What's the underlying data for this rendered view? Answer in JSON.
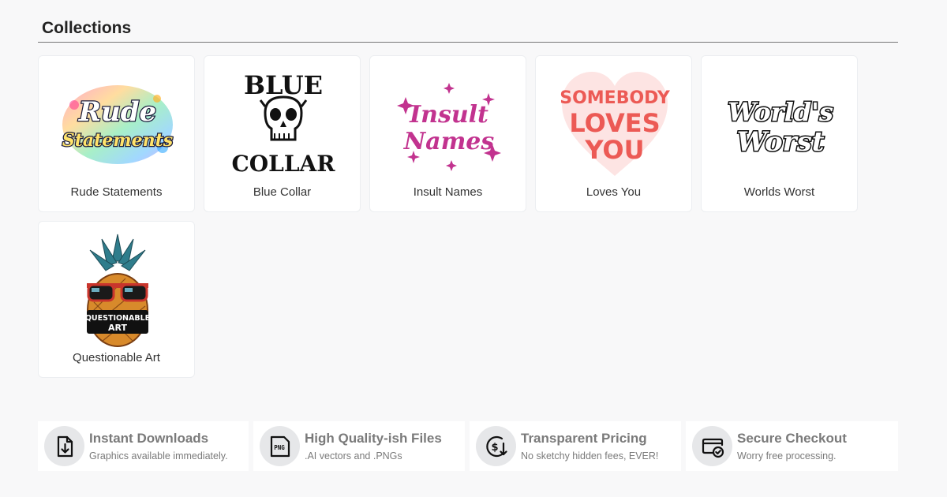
{
  "section": {
    "title": "Collections"
  },
  "collections": [
    {
      "label": "Rude Statements",
      "art_text": [
        "Rude",
        "Statements"
      ]
    },
    {
      "label": "Blue Collar",
      "art_text": [
        "BLUE",
        "COLLAR"
      ]
    },
    {
      "label": "Insult Names",
      "art_text": [
        "Insult",
        "Names"
      ]
    },
    {
      "label": "Loves You",
      "art_text": [
        "SOMEBODY",
        "LOVES",
        "YOU"
      ]
    },
    {
      "label": "Worlds Worst",
      "art_text": [
        "World's",
        "Worst"
      ]
    },
    {
      "label": "Questionable Art",
      "art_text": [
        "QUESTIONABLE",
        "ART"
      ]
    }
  ],
  "features": [
    {
      "title": "Instant Downloads",
      "subtitle": "Graphics available immediately.",
      "icon": "file-download-icon"
    },
    {
      "title": "High Quality-ish Files",
      "subtitle": ".AI vectors and .PNGs",
      "icon": "png-file-icon",
      "icon_text": "PNG"
    },
    {
      "title": "Transparent Pricing",
      "subtitle": "No sketchy hidden fees, EVER!",
      "icon": "dollar-down-icon",
      "icon_text": "$"
    },
    {
      "title": "Secure Checkout",
      "subtitle": "Worry free processing.",
      "icon": "secure-card-icon"
    }
  ],
  "colors": {
    "background": "#f8f8f9",
    "card": "#ffffff",
    "insult_pink": "#c2338f",
    "loves_red": "#ec5a55",
    "skull_black": "#111111",
    "feature_text": "#7a7a7a",
    "icon_circle": "#e6e7e9"
  }
}
